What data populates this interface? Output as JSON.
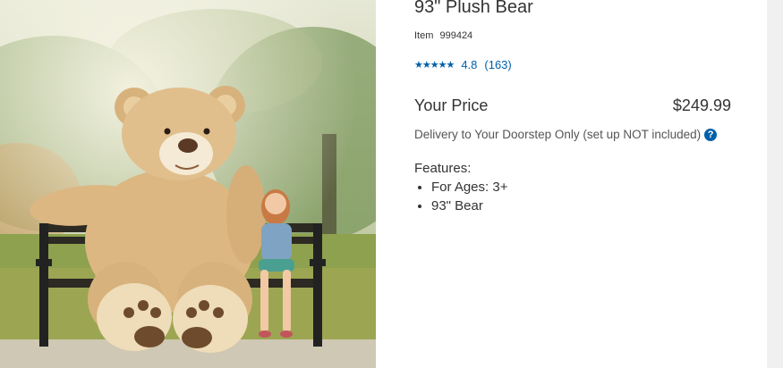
{
  "product": {
    "title": "93\" Plush Bear",
    "item_label": "Item",
    "item_number": "999424",
    "rating_value": "4.8",
    "review_count": "(163)",
    "price_label": "Your Price",
    "price": "$249.99",
    "delivery_note": "Delivery to Your Doorstep Only (set up NOT included)",
    "help_icon": "?",
    "features_heading": "Features:",
    "features": [
      "For Ages: 3+",
      "93\" Bear"
    ]
  },
  "colors": {
    "link": "#0060a9",
    "text": "#333333"
  },
  "icons": {
    "rating": "star-rating-icon",
    "help": "question-circle-icon"
  }
}
